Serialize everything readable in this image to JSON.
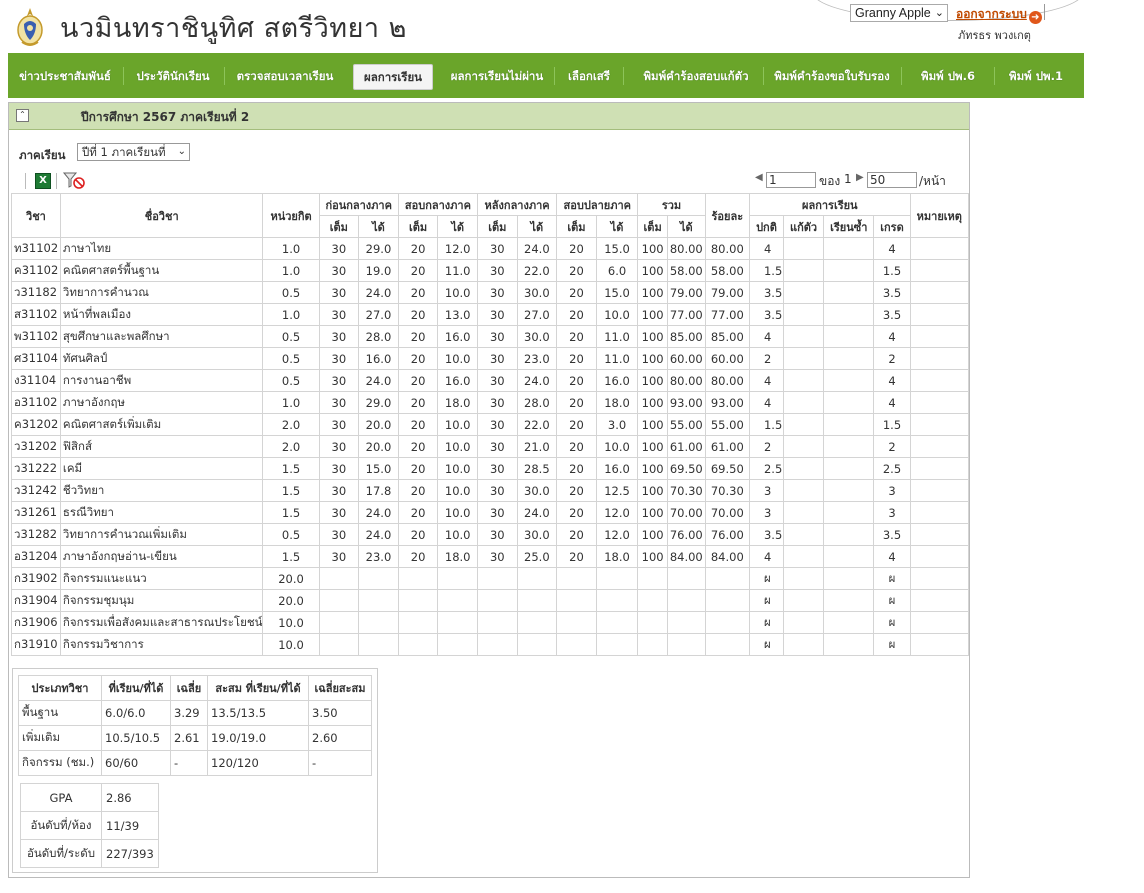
{
  "header": {
    "school_name": "นวมินทราชินูทิศ สตรีวิทยา ๒",
    "theme_select": "Granny Apple",
    "logout_label": "ออกจากระบบ",
    "user_name": "ภัทรธร พวงเกตุ"
  },
  "nav": {
    "items": [
      {
        "label": "ข่าวประชาสัมพันธ์"
      },
      {
        "label": "ประวัตินักเรียน"
      },
      {
        "label": "ตรวจสอบเวลาเรียน"
      },
      {
        "label": "ผลการเรียน",
        "active": true
      },
      {
        "label": "ผลการเรียนไม่ผ่าน"
      },
      {
        "label": "เลือกเสรี"
      },
      {
        "label": "พิมพ์คำร้องสอบแก้ตัว"
      },
      {
        "label": "พิมพ์คำร้องขอใบรับรอง"
      },
      {
        "label": "พิมพ์ ปพ.6"
      },
      {
        "label": "พิมพ์ ปพ.1"
      }
    ]
  },
  "panel": {
    "title": "ปีการศึกษา 2567 ภาคเรียนที่ 2",
    "term_label": "ภาคเรียน",
    "term_value": "ปีที่ 1 ภาคเรียนที่"
  },
  "pager": {
    "page_value": "1",
    "of_label": "ของ",
    "total_pages": "1",
    "page_size": "50",
    "per_page_label": "/หน้า"
  },
  "table": {
    "headers": {
      "code": "วิชา",
      "name": "ชื่อวิชา",
      "credit": "หน่วยกิต",
      "pre_mid": "ก่อนกลางภาค",
      "midterm": "สอบกลางภาค",
      "post_mid": "หลังกลางภาค",
      "final": "สอบปลายภาค",
      "total": "รวม",
      "percent": "ร้อยละ",
      "result": "ผลการเรียน",
      "note": "หมายเหตุ",
      "full": "เต็ม",
      "got": "ได้",
      "normal": "ปกติ",
      "retake": "แก้ตัว",
      "repeat": "เรียนซ้ำ",
      "grade": "เกรด"
    },
    "rows": [
      {
        "code": "ท31102",
        "name": "ภาษาไทย",
        "credit": "1.0",
        "c1": "30",
        "s1": "29.0",
        "c2": "20",
        "s2": "12.0",
        "c3": "30",
        "s3": "24.0",
        "c4": "20",
        "s4": "15.0",
        "tf": "100",
        "tg": "80.00",
        "pct": "80.00",
        "normal": "4",
        "retake": "",
        "repeat": "",
        "grade": "4",
        "note": ""
      },
      {
        "code": "ค31102",
        "name": "คณิตศาสตร์พื้นฐาน",
        "credit": "1.0",
        "c1": "30",
        "s1": "19.0",
        "c2": "20",
        "s2": "11.0",
        "c3": "30",
        "s3": "22.0",
        "c4": "20",
        "s4": "6.0",
        "tf": "100",
        "tg": "58.00",
        "pct": "58.00",
        "normal": "1.5",
        "retake": "",
        "repeat": "",
        "grade": "1.5",
        "note": ""
      },
      {
        "code": "ว31182",
        "name": "วิทยาการคำนวณ",
        "credit": "0.5",
        "c1": "30",
        "s1": "24.0",
        "c2": "20",
        "s2": "10.0",
        "c3": "30",
        "s3": "30.0",
        "c4": "20",
        "s4": "15.0",
        "tf": "100",
        "tg": "79.00",
        "pct": "79.00",
        "normal": "3.5",
        "retake": "",
        "repeat": "",
        "grade": "3.5",
        "note": ""
      },
      {
        "code": "ส31102",
        "name": "หน้าที่พลเมือง",
        "credit": "1.0",
        "c1": "30",
        "s1": "27.0",
        "c2": "20",
        "s2": "13.0",
        "c3": "30",
        "s3": "27.0",
        "c4": "20",
        "s4": "10.0",
        "tf": "100",
        "tg": "77.00",
        "pct": "77.00",
        "normal": "3.5",
        "retake": "",
        "repeat": "",
        "grade": "3.5",
        "note": ""
      },
      {
        "code": "พ31102",
        "name": "สุขศึกษาและพลศึกษา",
        "credit": "0.5",
        "c1": "30",
        "s1": "28.0",
        "c2": "20",
        "s2": "16.0",
        "c3": "30",
        "s3": "30.0",
        "c4": "20",
        "s4": "11.0",
        "tf": "100",
        "tg": "85.00",
        "pct": "85.00",
        "normal": "4",
        "retake": "",
        "repeat": "",
        "grade": "4",
        "note": ""
      },
      {
        "code": "ศ31104",
        "name": "ทัศนศิลป์",
        "credit": "0.5",
        "c1": "30",
        "s1": "16.0",
        "c2": "20",
        "s2": "10.0",
        "c3": "30",
        "s3": "23.0",
        "c4": "20",
        "s4": "11.0",
        "tf": "100",
        "tg": "60.00",
        "pct": "60.00",
        "normal": "2",
        "retake": "",
        "repeat": "",
        "grade": "2",
        "note": ""
      },
      {
        "code": "ง31104",
        "name": "การงานอาชีพ",
        "credit": "0.5",
        "c1": "30",
        "s1": "24.0",
        "c2": "20",
        "s2": "16.0",
        "c3": "30",
        "s3": "24.0",
        "c4": "20",
        "s4": "16.0",
        "tf": "100",
        "tg": "80.00",
        "pct": "80.00",
        "normal": "4",
        "retake": "",
        "repeat": "",
        "grade": "4",
        "note": ""
      },
      {
        "code": "อ31102",
        "name": "ภาษาอังกฤษ",
        "credit": "1.0",
        "c1": "30",
        "s1": "29.0",
        "c2": "20",
        "s2": "18.0",
        "c3": "30",
        "s3": "28.0",
        "c4": "20",
        "s4": "18.0",
        "tf": "100",
        "tg": "93.00",
        "pct": "93.00",
        "normal": "4",
        "retake": "",
        "repeat": "",
        "grade": "4",
        "note": ""
      },
      {
        "code": "ค31202",
        "name": "คณิตศาสตร์เพิ่มเติม",
        "credit": "2.0",
        "c1": "30",
        "s1": "20.0",
        "c2": "20",
        "s2": "10.0",
        "c3": "30",
        "s3": "22.0",
        "c4": "20",
        "s4": "3.0",
        "tf": "100",
        "tg": "55.00",
        "pct": "55.00",
        "normal": "1.5",
        "retake": "",
        "repeat": "",
        "grade": "1.5",
        "note": ""
      },
      {
        "code": "ว31202",
        "name": "ฟิสิกส์",
        "credit": "2.0",
        "c1": "30",
        "s1": "20.0",
        "c2": "20",
        "s2": "10.0",
        "c3": "30",
        "s3": "21.0",
        "c4": "20",
        "s4": "10.0",
        "tf": "100",
        "tg": "61.00",
        "pct": "61.00",
        "normal": "2",
        "retake": "",
        "repeat": "",
        "grade": "2",
        "note": ""
      },
      {
        "code": "ว31222",
        "name": "เคมี",
        "credit": "1.5",
        "c1": "30",
        "s1": "15.0",
        "c2": "20",
        "s2": "10.0",
        "c3": "30",
        "s3": "28.5",
        "c4": "20",
        "s4": "16.0",
        "tf": "100",
        "tg": "69.50",
        "pct": "69.50",
        "normal": "2.5",
        "retake": "",
        "repeat": "",
        "grade": "2.5",
        "note": ""
      },
      {
        "code": "ว31242",
        "name": "ชีววิทยา",
        "credit": "1.5",
        "c1": "30",
        "s1": "17.8",
        "c2": "20",
        "s2": "10.0",
        "c3": "30",
        "s3": "30.0",
        "c4": "20",
        "s4": "12.5",
        "tf": "100",
        "tg": "70.30",
        "pct": "70.30",
        "normal": "3",
        "retake": "",
        "repeat": "",
        "grade": "3",
        "note": ""
      },
      {
        "code": "ว31261",
        "name": "ธรณีวิทยา",
        "credit": "1.5",
        "c1": "30",
        "s1": "24.0",
        "c2": "20",
        "s2": "10.0",
        "c3": "30",
        "s3": "24.0",
        "c4": "20",
        "s4": "12.0",
        "tf": "100",
        "tg": "70.00",
        "pct": "70.00",
        "normal": "3",
        "retake": "",
        "repeat": "",
        "grade": "3",
        "note": ""
      },
      {
        "code": "ว31282",
        "name": "วิทยาการคำนวณเพิ่มเติม",
        "credit": "0.5",
        "c1": "30",
        "s1": "24.0",
        "c2": "20",
        "s2": "10.0",
        "c3": "30",
        "s3": "30.0",
        "c4": "20",
        "s4": "12.0",
        "tf": "100",
        "tg": "76.00",
        "pct": "76.00",
        "normal": "3.5",
        "retake": "",
        "repeat": "",
        "grade": "3.5",
        "note": ""
      },
      {
        "code": "อ31204",
        "name": "ภาษาอังกฤษอ่าน-เขียน",
        "credit": "1.5",
        "c1": "30",
        "s1": "23.0",
        "c2": "20",
        "s2": "18.0",
        "c3": "30",
        "s3": "25.0",
        "c4": "20",
        "s4": "18.0",
        "tf": "100",
        "tg": "84.00",
        "pct": "84.00",
        "normal": "4",
        "retake": "",
        "repeat": "",
        "grade": "4",
        "note": ""
      },
      {
        "code": "ก31902",
        "name": "กิจกรรมแนะแนว",
        "credit": "20.0",
        "c1": "",
        "s1": "",
        "c2": "",
        "s2": "",
        "c3": "",
        "s3": "",
        "c4": "",
        "s4": "",
        "tf": "",
        "tg": "",
        "pct": "",
        "normal": "ผ",
        "retake": "",
        "repeat": "",
        "grade": "ผ",
        "note": ""
      },
      {
        "code": "ก31904",
        "name": "กิจกรรมชุมนุม",
        "credit": "20.0",
        "c1": "",
        "s1": "",
        "c2": "",
        "s2": "",
        "c3": "",
        "s3": "",
        "c4": "",
        "s4": "",
        "tf": "",
        "tg": "",
        "pct": "",
        "normal": "ผ",
        "retake": "",
        "repeat": "",
        "grade": "ผ",
        "note": ""
      },
      {
        "code": "ก31906",
        "name": "กิจกรรมเพื่อสังคมและสาธารณประโยชน์",
        "credit": "10.0",
        "c1": "",
        "s1": "",
        "c2": "",
        "s2": "",
        "c3": "",
        "s3": "",
        "c4": "",
        "s4": "",
        "tf": "",
        "tg": "",
        "pct": "",
        "normal": "ผ",
        "retake": "",
        "repeat": "",
        "grade": "ผ",
        "note": ""
      },
      {
        "code": "ก31910",
        "name": "กิจกรรมวิชาการ",
        "credit": "10.0",
        "c1": "",
        "s1": "",
        "c2": "",
        "s2": "",
        "c3": "",
        "s3": "",
        "c4": "",
        "s4": "",
        "tf": "",
        "tg": "",
        "pct": "",
        "normal": "ผ",
        "retake": "",
        "repeat": "",
        "grade": "ผ",
        "note": ""
      }
    ]
  },
  "summary": {
    "headers": {
      "type": "ประเภทวิชา",
      "studied": "ที่เรียน/ที่ได้",
      "avg": "เฉลี่ย",
      "cum_studied": "สะสม ที่เรียน/ที่ได้",
      "cum_avg": "เฉลี่ยสะสม"
    },
    "rows": [
      {
        "type": "พื้นฐาน",
        "studied": "6.0/6.0",
        "avg": "3.29",
        "cum_studied": "13.5/13.5",
        "cum_avg": "3.50"
      },
      {
        "type": "เพิ่มเติม",
        "studied": "10.5/10.5",
        "avg": "2.61",
        "cum_studied": "19.0/19.0",
        "cum_avg": "2.60"
      },
      {
        "type": "กิจกรรม (ชม.)",
        "studied": "60/60",
        "avg": "-",
        "cum_studied": "120/120",
        "cum_avg": "-"
      }
    ],
    "gpa_label": "GPA",
    "gpa_value": "2.86",
    "class_rank_label": "อันดับที่/ห้อง",
    "class_rank_value": "11/39",
    "level_rank_label": "อันดับที่/ระดับ",
    "level_rank_value": "227/393"
  }
}
